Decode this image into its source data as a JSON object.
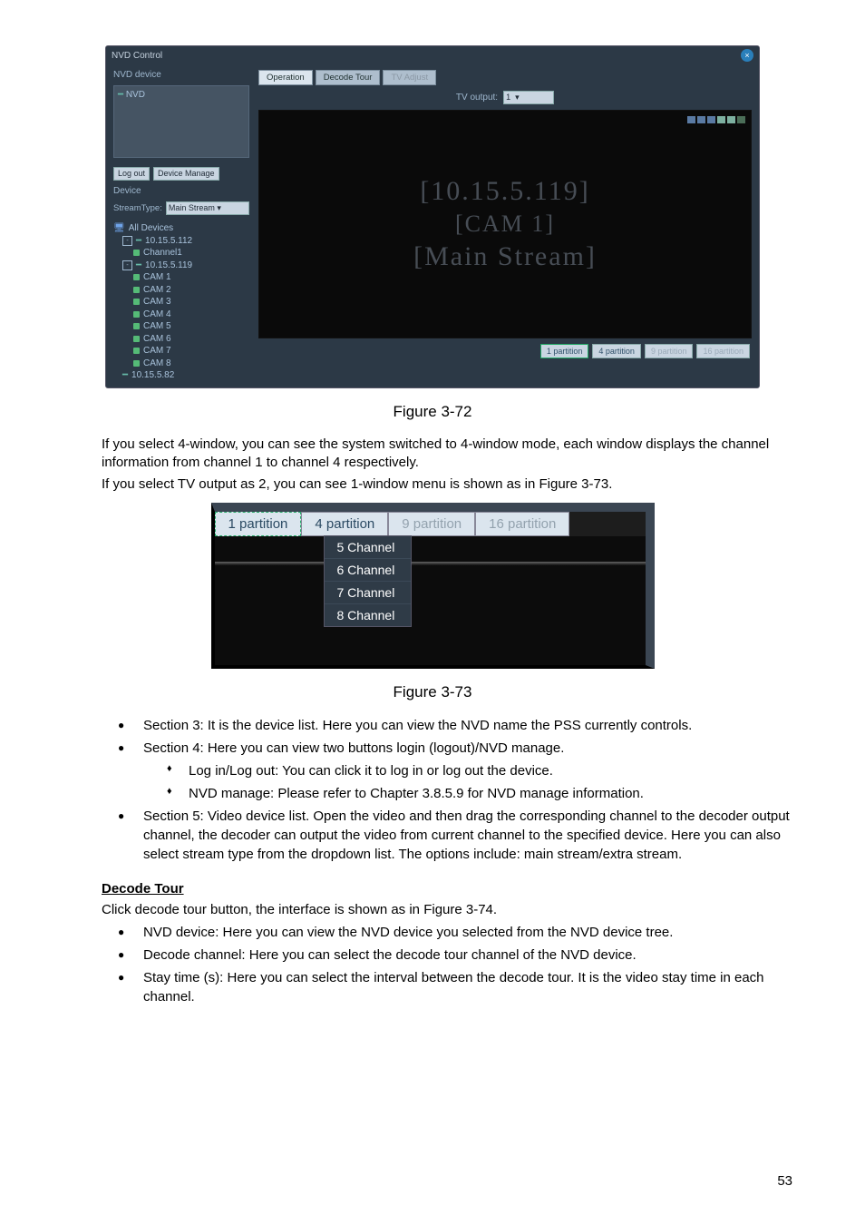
{
  "fig72": {
    "window_title": "NVD Control",
    "left": {
      "nvd_device_label": "NVD device",
      "nvd_root": "NVD",
      "logout_btn": "Log out",
      "device_manage_btn": "Device Manage",
      "device_label": "Device",
      "streamtype_label": "StreamType:",
      "streamtype_value": "Main Stream",
      "tree": {
        "root": "All Devices",
        "dev1": {
          "ip": "10.15.5.112",
          "channels": [
            "Channel1"
          ],
          "expanded": "-"
        },
        "dev2": {
          "ip": "10.15.5.119",
          "channels": [
            "CAM 1",
            "CAM 2",
            "CAM 3",
            "CAM 4",
            "CAM 5",
            "CAM 6",
            "CAM 7",
            "CAM 8"
          ],
          "expanded": "-"
        },
        "dev3": {
          "ip": "10.15.5.82"
        }
      }
    },
    "right": {
      "tabs": {
        "operation": "Operation",
        "decode_tour": "Decode Tour",
        "tv_adjust": "TV Adjust"
      },
      "tv_output_label": "TV output:",
      "tv_output_value": "1",
      "overlay": {
        "line1": "[10.15.5.119]",
        "line2": "[CAM 1]",
        "line3": "[Main Stream]"
      },
      "palette": [
        "#5a7aa3",
        "#5a7aa3",
        "#5a7aa3",
        "#7db0a0",
        "#7db0a0",
        "#4b6e58"
      ],
      "partitions": {
        "p1": "1 partition",
        "p4": "4 partition",
        "p9": "9 partition",
        "p16": "16 partition"
      }
    },
    "caption": "Figure 3-72"
  },
  "body1": {
    "p1": "If you select 4-window, you can see the system switched to 4-window mode, each window displays the channel information from channel 1 to channel 4 respectively.",
    "p2": "If you select TV output as 2, you can see 1-window menu is shown as in Figure 3-73."
  },
  "fig73": {
    "tabs": {
      "p1": "1 partition",
      "p4": "4 partition",
      "p9": "9 partition",
      "p16": "16 partition"
    },
    "menu": [
      "5 Channel",
      "6 Channel",
      "7 Channel",
      "8 Channel"
    ],
    "caption": "Figure 3-73"
  },
  "bullets1": {
    "s3": "Section 3: It is the device list. Here you can view the NVD name the PSS currently controls.",
    "s4": "Section 4: Here you can view two buttons login (logout)/NVD manage.",
    "s4a": "Log in/Log out: You can click it to log in or log out the device.",
    "s4b": "NVD manage: Please refer to Chapter 3.8.5.9 for NVD manage information.",
    "s5": "Section 5: Video device list. Open the video and then drag the corresponding channel to the decoder output channel, the decoder can output the video from current channel to the specified device. Here you can also select stream type from the dropdown list. The options include: main stream/extra stream."
  },
  "decode_tour": {
    "heading": "Decode Tour",
    "intro": "Click decode tour button, the interface is shown as in Figure 3-74.",
    "b1": "NVD device: Here you can view the NVD device you selected from the NVD device tree.",
    "b2": "Decode channel: Here you can select the decode tour channel of the NVD device.",
    "b3": "Stay time (s): Here you can select the interval between the decode tour. It is the video stay time in each channel."
  },
  "page_number": "53"
}
